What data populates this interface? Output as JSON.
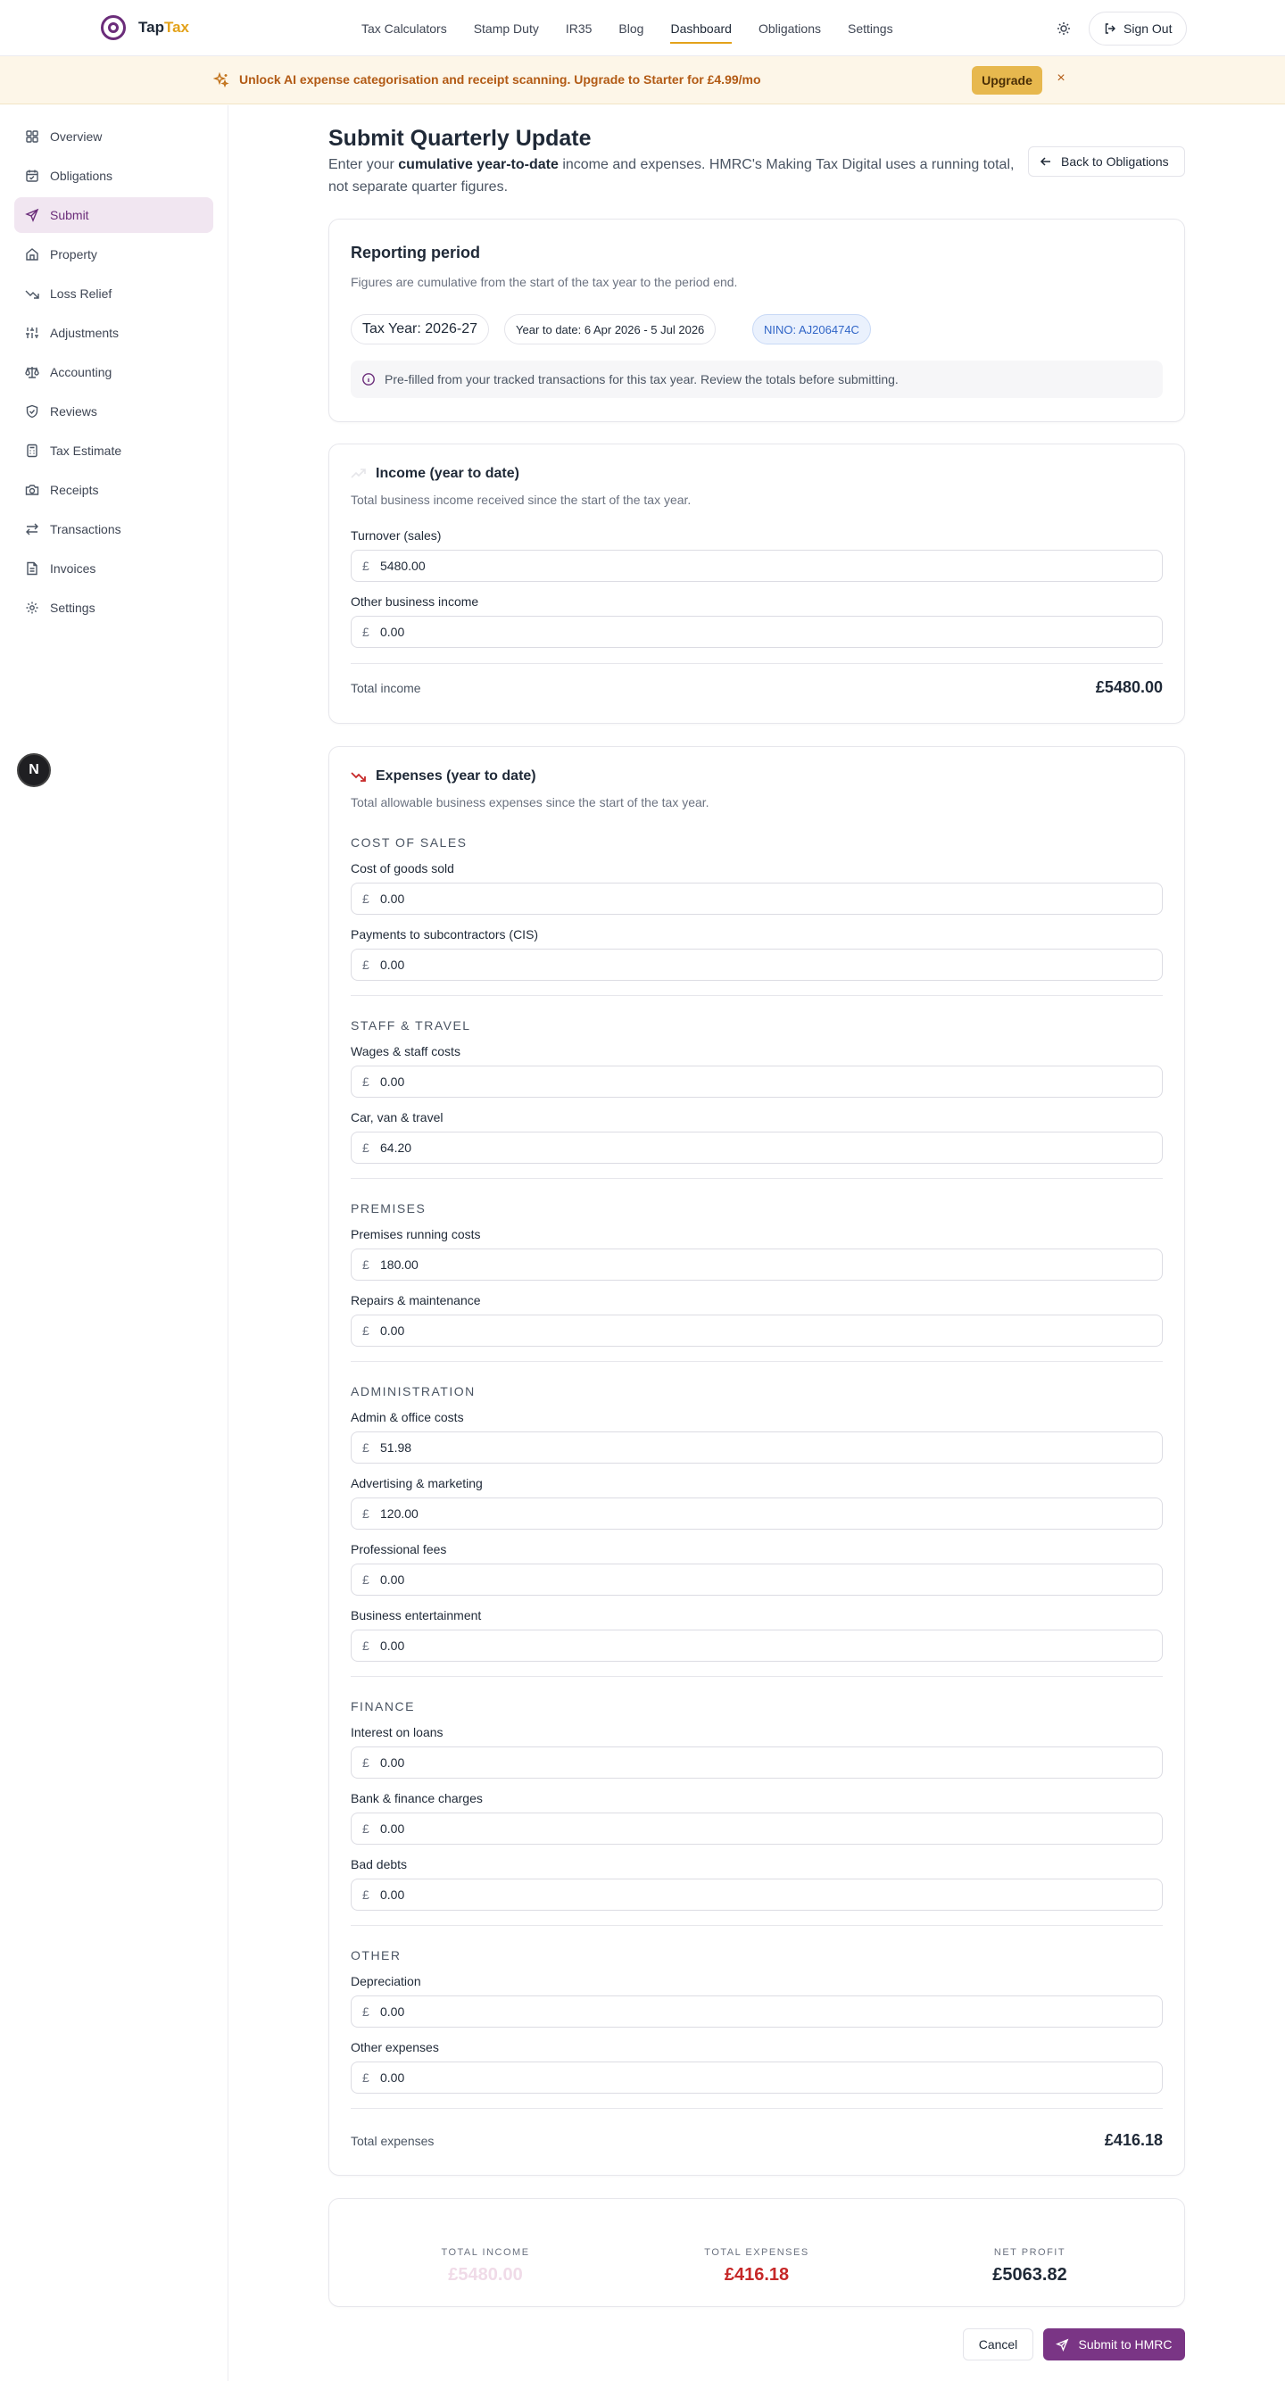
{
  "brand": {
    "name_main": "Tap",
    "name_accent": "Tax"
  },
  "nav": {
    "links": [
      "Tax Calculators",
      "Stamp Duty",
      "IR35",
      "Blog",
      "Dashboard",
      "Obligations",
      "Settings"
    ],
    "active": "Dashboard",
    "signout_label": "Sign Out"
  },
  "banner": {
    "text": "Unlock AI expense categorisation and receipt scanning. Upgrade to Starter for ",
    "price": "£4.99/mo",
    "upgrade_label": "Upgrade",
    "close_glyph": "×"
  },
  "sidebar": {
    "items": [
      {
        "label": "Overview",
        "icon": "grid-icon"
      },
      {
        "label": "Obligations",
        "icon": "calendar-icon"
      },
      {
        "label": "Submit",
        "icon": "send-icon",
        "active": true
      },
      {
        "label": "Property",
        "icon": "home-icon"
      },
      {
        "label": "Loss Relief",
        "icon": "trending-down-icon"
      },
      {
        "label": "Adjustments",
        "icon": "sliders-icon"
      },
      {
        "label": "Accounting",
        "icon": "scale-icon"
      },
      {
        "label": "Reviews",
        "icon": "shield-check-icon"
      },
      {
        "label": "Tax Estimate",
        "icon": "calculator-icon"
      },
      {
        "label": "Receipts",
        "icon": "camera-icon"
      },
      {
        "label": "Transactions",
        "icon": "arrows-swap-icon"
      },
      {
        "label": "Invoices",
        "icon": "file-icon"
      },
      {
        "label": "Settings",
        "icon": "gear-icon"
      }
    ],
    "fab_label": "N"
  },
  "page": {
    "title": "Submit Quarterly Update",
    "desc_prefix": "Enter your ",
    "desc_bold": "cumulative year-to-date",
    "desc_suffix": " income and expenses. HMRC's Making Tax Digital uses a running total, not separate quarter figures.",
    "back_label": "Back to Obligations"
  },
  "period": {
    "title": "Reporting period",
    "subtitle": "Figures are cumulative from the start of the tax year to the period end.",
    "tax_year": "Tax Year: 2026-27",
    "ytd": "Year to date: 6 Apr 2026 - 5 Jul 2026",
    "nino": "NINO: AJ206474C",
    "note": "Pre-filled from your tracked transactions for this tax year. Review the totals before submitting."
  },
  "income": {
    "title": "Income (year to date)",
    "subtitle": "Total business income received since the start of the tax year.",
    "currency": "£",
    "fields": [
      {
        "label": "Turnover (sales)",
        "value": "5480.00"
      },
      {
        "label": "Other business income",
        "value": "0.00"
      }
    ],
    "total_label": "Total income",
    "total_value": "£5480.00"
  },
  "expenses": {
    "title": "Expenses (year to date)",
    "subtitle": "Total allowable business expenses since the start of the tax year.",
    "currency": "£",
    "sections": [
      {
        "heading": "COST OF SALES",
        "fields": [
          {
            "label": "Cost of goods sold",
            "value": "0.00"
          },
          {
            "label": "Payments to subcontractors (CIS)",
            "value": "0.00"
          }
        ]
      },
      {
        "heading": "STAFF & TRAVEL",
        "fields": [
          {
            "label": "Wages & staff costs",
            "value": "0.00"
          },
          {
            "label": "Car, van & travel",
            "value": "64.20"
          }
        ]
      },
      {
        "heading": "PREMISES",
        "fields": [
          {
            "label": "Premises running costs",
            "value": "180.00"
          },
          {
            "label": "Repairs & maintenance",
            "value": "0.00"
          }
        ]
      },
      {
        "heading": "ADMINISTRATION",
        "fields": [
          {
            "label": "Admin & office costs",
            "value": "51.98"
          },
          {
            "label": "Advertising & marketing",
            "value": "120.00"
          },
          {
            "label": "Professional fees",
            "value": "0.00"
          },
          {
            "label": "Business entertainment",
            "value": "0.00"
          }
        ]
      },
      {
        "heading": "FINANCE",
        "fields": [
          {
            "label": "Interest on loans",
            "value": "0.00"
          },
          {
            "label": "Bank & finance charges",
            "value": "0.00"
          },
          {
            "label": "Bad debts",
            "value": "0.00"
          }
        ]
      },
      {
        "heading": "OTHER",
        "fields": [
          {
            "label": "Depreciation",
            "value": "0.00"
          },
          {
            "label": "Other expenses",
            "value": "0.00"
          }
        ]
      }
    ],
    "total_label": "Total expenses",
    "total_value": "£416.18"
  },
  "summary": {
    "income_label": "TOTAL INCOME",
    "income_value": "£5480.00",
    "expenses_label": "TOTAL EXPENSES",
    "expenses_value": "£416.18",
    "profit_label": "NET PROFIT",
    "profit_value": "£5063.82"
  },
  "actions": {
    "cancel_label": "Cancel",
    "submit_label": "Submit to HMRC"
  },
  "colors": {
    "brand": "#6b2d7a",
    "accent": "#e3a21a",
    "income_total": "#f0dbe8",
    "expense_total": "#c62828",
    "submit": "#7a3585"
  }
}
